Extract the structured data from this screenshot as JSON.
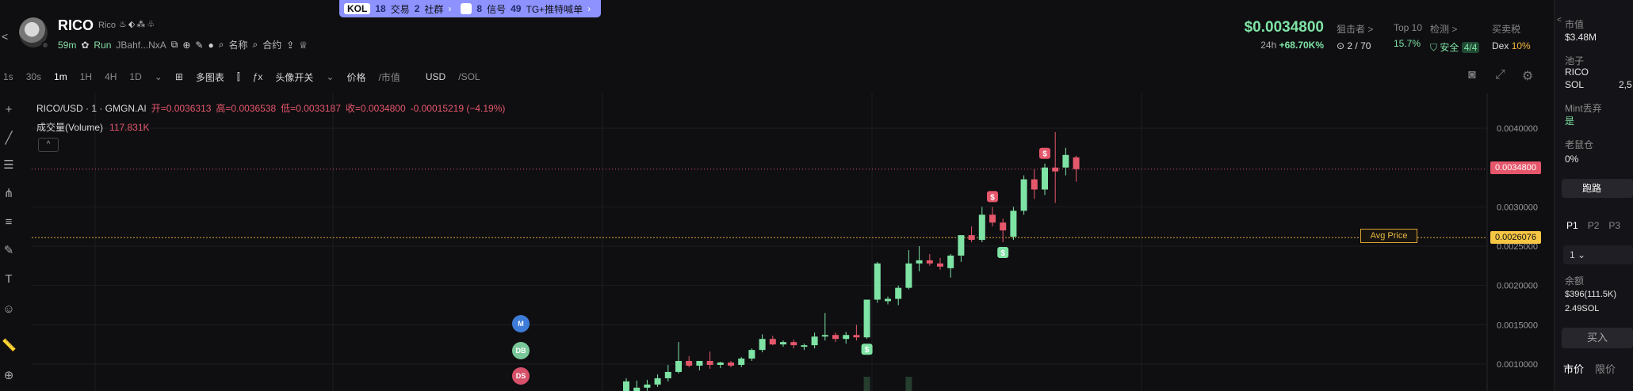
{
  "promo": {
    "kol_tag": "KOL",
    "trades_num": "18",
    "trades_label": "交易",
    "groups_num": "2",
    "groups_label": "社群",
    "signals_num": "8",
    "signals_label": "信号",
    "tg_num": "49",
    "tg_label": "TG+推特喊单"
  },
  "token": {
    "symbol": "RICO",
    "name": "Rico",
    "age": "59m",
    "run": "Run",
    "address": "JBahf...NxA",
    "name_link": "名称",
    "contract_link": "合约"
  },
  "price": {
    "value": "$0.0034800",
    "change_label": "24h",
    "change_value": "+68.70K%"
  },
  "stats": {
    "snipers_label": "狙击者 >",
    "snipers_value": "2 / 70",
    "top10_label": "Top 10",
    "top10_value": "15.7%",
    "check_label": "检测 >",
    "check_value": "安全",
    "check_badge": "4/4",
    "tax_label": "买卖税",
    "tax_dex": "Dex",
    "tax_value": "10%"
  },
  "toolbar": {
    "intervals": [
      "1s",
      "30s",
      "1m",
      "1H",
      "4H",
      "1D"
    ],
    "active_interval": "1m",
    "multi_chart": "多图表",
    "avatar_toggle": "头像开关",
    "price_label": "价格",
    "mcap_label": "市值",
    "usd_label": "USD",
    "sol_label": "SOL"
  },
  "legend": {
    "pair": "RICO/USD · 1 · GMGN.AI",
    "open": "开=0.0036313",
    "high": "高=0.0036538",
    "low": "低=0.0033187",
    "close": "收=0.0034800",
    "change": "-0.00015219 (−4.19%)",
    "volume_label": "成交量(Volume)",
    "volume_value": "117.831K",
    "collapse": "^"
  },
  "overlays": {
    "current_price_tag": "0.0034800",
    "avg_price_tag": "0.0026076",
    "avg_price_label": "Avg Price",
    "marker_m": "M",
    "marker_db": "DB",
    "marker_ds": "DS"
  },
  "chart_data": {
    "type": "candlestick",
    "y_ticks": [
      "0.0040000",
      "0.0030000",
      "0.0025000",
      "0.0020000",
      "0.0015000",
      "0.0010000"
    ],
    "ylim": [
      0.00075,
      0.00425
    ],
    "current_price": 0.00348,
    "avg_price": 0.0026076,
    "colors": {
      "up": "#7ee3a4",
      "down": "#e6576b",
      "avg": "#d9a52f"
    },
    "candles": [
      {
        "o": 0.00056,
        "h": 0.00082,
        "l": 0.0005,
        "c": 0.00078
      },
      {
        "o": 0.00062,
        "h": 0.00079,
        "l": 0.00058,
        "c": 0.0007
      },
      {
        "o": 0.0007,
        "h": 0.0008,
        "l": 0.00066,
        "c": 0.00074
      },
      {
        "o": 0.00074,
        "h": 0.00087,
        "l": 0.00071,
        "c": 0.00082
      },
      {
        "o": 0.00082,
        "h": 0.00099,
        "l": 0.00078,
        "c": 0.0009
      },
      {
        "o": 0.0009,
        "h": 0.00128,
        "l": 0.00088,
        "c": 0.00104
      },
      {
        "o": 0.00104,
        "h": 0.0011,
        "l": 0.00096,
        "c": 0.00098
      },
      {
        "o": 0.00098,
        "h": 0.00104,
        "l": 0.00092,
        "c": 0.00104
      },
      {
        "o": 0.00104,
        "h": 0.00116,
        "l": 0.00094,
        "c": 0.00099
      },
      {
        "o": 0.00099,
        "h": 0.00103,
        "l": 0.00095,
        "c": 0.00102
      },
      {
        "o": 0.00102,
        "h": 0.00104,
        "l": 0.00096,
        "c": 0.00098
      },
      {
        "o": 0.00099,
        "h": 0.00109,
        "l": 0.00096,
        "c": 0.00107
      },
      {
        "o": 0.00107,
        "h": 0.0012,
        "l": 0.00104,
        "c": 0.00118
      },
      {
        "o": 0.00118,
        "h": 0.00138,
        "l": 0.00115,
        "c": 0.00132
      },
      {
        "o": 0.00132,
        "h": 0.00136,
        "l": 0.00124,
        "c": 0.00125
      },
      {
        "o": 0.00125,
        "h": 0.0013,
        "l": 0.00122,
        "c": 0.00128
      },
      {
        "o": 0.00128,
        "h": 0.00131,
        "l": 0.0012,
        "c": 0.00124
      },
      {
        "o": 0.00122,
        "h": 0.00126,
        "l": 0.00118,
        "c": 0.00124
      },
      {
        "o": 0.00124,
        "h": 0.0014,
        "l": 0.0012,
        "c": 0.00135
      },
      {
        "o": 0.00135,
        "h": 0.00165,
        "l": 0.0013,
        "c": 0.00137
      },
      {
        "o": 0.00137,
        "h": 0.0014,
        "l": 0.00128,
        "c": 0.00132
      },
      {
        "o": 0.00132,
        "h": 0.00141,
        "l": 0.00126,
        "c": 0.00137
      },
      {
        "o": 0.00137,
        "h": 0.0015,
        "l": 0.0013,
        "c": 0.00134
      },
      {
        "o": 0.00134,
        "h": 0.0018,
        "l": 0.00132,
        "c": 0.00182
      },
      {
        "o": 0.00182,
        "h": 0.0023,
        "l": 0.00178,
        "c": 0.00228
      },
      {
        "o": 0.0018,
        "h": 0.00186,
        "l": 0.00176,
        "c": 0.00183
      },
      {
        "o": 0.00183,
        "h": 0.002,
        "l": 0.00175,
        "c": 0.00197
      },
      {
        "o": 0.00197,
        "h": 0.00245,
        "l": 0.00195,
        "c": 0.00228
      },
      {
        "o": 0.00228,
        "h": 0.0025,
        "l": 0.00218,
        "c": 0.00232
      },
      {
        "o": 0.00232,
        "h": 0.0024,
        "l": 0.00225,
        "c": 0.00228
      },
      {
        "o": 0.00228,
        "h": 0.00235,
        "l": 0.0022,
        "c": 0.00224
      },
      {
        "o": 0.00222,
        "h": 0.0024,
        "l": 0.0021,
        "c": 0.00238
      },
      {
        "o": 0.00238,
        "h": 0.00262,
        "l": 0.0023,
        "c": 0.00264
      },
      {
        "o": 0.00264,
        "h": 0.00275,
        "l": 0.00255,
        "c": 0.00258
      },
      {
        "o": 0.00258,
        "h": 0.003,
        "l": 0.00255,
        "c": 0.0029
      },
      {
        "o": 0.0029,
        "h": 0.003,
        "l": 0.00275,
        "c": 0.0028
      },
      {
        "o": 0.0028,
        "h": 0.00285,
        "l": 0.00255,
        "c": 0.0027
      },
      {
        "o": 0.00262,
        "h": 0.003,
        "l": 0.00258,
        "c": 0.00295
      },
      {
        "o": 0.00295,
        "h": 0.0034,
        "l": 0.0029,
        "c": 0.00335
      },
      {
        "o": 0.00335,
        "h": 0.00348,
        "l": 0.0031,
        "c": 0.00322
      },
      {
        "o": 0.00322,
        "h": 0.00355,
        "l": 0.00315,
        "c": 0.0035
      },
      {
        "o": 0.0035,
        "h": 0.00395,
        "l": 0.00305,
        "c": 0.00345
      },
      {
        "o": 0.0035,
        "h": 0.00375,
        "l": 0.0034,
        "c": 0.00366
      },
      {
        "o": 0.00363,
        "h": 0.00365,
        "l": 0.00332,
        "c": 0.00348
      }
    ],
    "trade_markers": [
      {
        "candle": 23,
        "side": "B"
      },
      {
        "candle": 35,
        "side": "S"
      },
      {
        "candle": 36,
        "side": "B"
      },
      {
        "candle": 40,
        "side": "S"
      }
    ]
  },
  "right_panel": {
    "mcap_label": "市值",
    "mcap_value": "$3.48M",
    "pool_label": "池子",
    "pool_token": "RICO",
    "pool_sol": "SOL",
    "pool_sol_value": "2,5",
    "mint_label": "Mint丢弃",
    "mint_value": "是",
    "rat_label": "老鼠仓",
    "rat_value": "0%",
    "run_button": "跑路",
    "tabs": [
      "P1",
      "P2",
      "P3"
    ],
    "select_value": "1",
    "balance_label": "余额",
    "balance_usd": "$396(111.5K)",
    "balance_sol": "2.49SOL",
    "buy_button": "买入",
    "mode_market": "市价",
    "mode_limit": "限价"
  }
}
